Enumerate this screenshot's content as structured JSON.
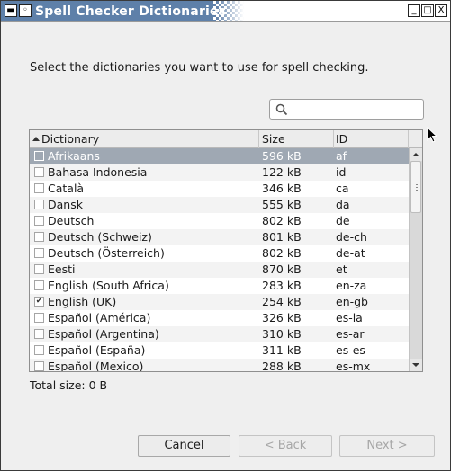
{
  "window": {
    "title": "Spell Checker Dictionaries",
    "controls": {
      "minimize": "_",
      "maximize": "□",
      "close": "X"
    }
  },
  "instruction": "Select the dictionaries you want to use for spell checking.",
  "search": {
    "value": "",
    "placeholder": ""
  },
  "table": {
    "columns": {
      "dictionary": "Dictionary",
      "size": "Size",
      "id": "ID"
    },
    "sort": {
      "column": "dictionary",
      "direction": "ascending"
    },
    "rows": [
      {
        "name": "Afrikaans",
        "size": "596 kB",
        "id": "af",
        "checked": false,
        "selected": true
      },
      {
        "name": "Bahasa Indonesia",
        "size": "122 kB",
        "id": "id",
        "checked": false,
        "selected": false
      },
      {
        "name": "Català",
        "size": "346 kB",
        "id": "ca",
        "checked": false,
        "selected": false
      },
      {
        "name": "Dansk",
        "size": "555 kB",
        "id": "da",
        "checked": false,
        "selected": false
      },
      {
        "name": "Deutsch",
        "size": "802 kB",
        "id": "de",
        "checked": false,
        "selected": false
      },
      {
        "name": "Deutsch (Schweiz)",
        "size": "801 kB",
        "id": "de-ch",
        "checked": false,
        "selected": false
      },
      {
        "name": "Deutsch (Österreich)",
        "size": "802 kB",
        "id": "de-at",
        "checked": false,
        "selected": false
      },
      {
        "name": "Eesti",
        "size": "870 kB",
        "id": "et",
        "checked": false,
        "selected": false
      },
      {
        "name": "English (South Africa)",
        "size": "283 kB",
        "id": "en-za",
        "checked": false,
        "selected": false
      },
      {
        "name": "English (UK)",
        "size": "254 kB",
        "id": "en-gb",
        "checked": true,
        "selected": false
      },
      {
        "name": "Español (América)",
        "size": "326 kB",
        "id": "es-la",
        "checked": false,
        "selected": false
      },
      {
        "name": "Español (Argentina)",
        "size": "310 kB",
        "id": "es-ar",
        "checked": false,
        "selected": false
      },
      {
        "name": "Español (España)",
        "size": "311 kB",
        "id": "es-es",
        "checked": false,
        "selected": false
      },
      {
        "name": "Español (Mexico)",
        "size": "288 kB",
        "id": "es-mx",
        "checked": false,
        "selected": false
      }
    ]
  },
  "total_size": "Total size: 0 B",
  "buttons": {
    "cancel": "Cancel",
    "back": "< Back",
    "next": "Next >"
  },
  "colors": {
    "titlebar": "#5e80a9",
    "selected_row": "#9fa8b3",
    "window_bg": "#efefef"
  }
}
